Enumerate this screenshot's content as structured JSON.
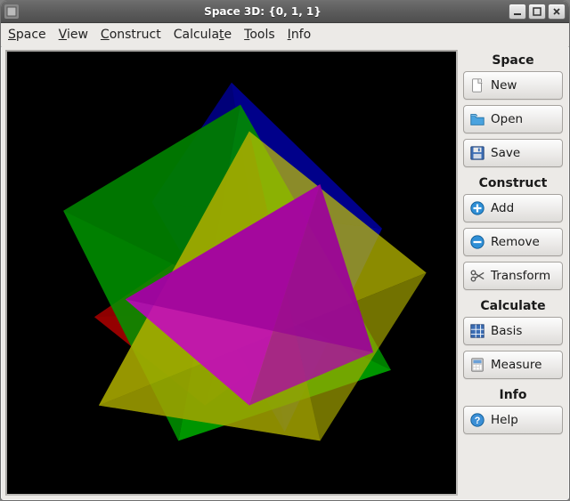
{
  "window": {
    "title": "Space 3D: {0, 1, 1}"
  },
  "menubar": {
    "items": [
      {
        "label": "Space",
        "accel_index": 0
      },
      {
        "label": "View",
        "accel_index": 0
      },
      {
        "label": "Construct",
        "accel_index": 0
      },
      {
        "label": "Calculate",
        "accel_index": 7
      },
      {
        "label": "Tools",
        "accel_index": 0
      },
      {
        "label": "Info",
        "accel_index": 0
      }
    ]
  },
  "sidebar": {
    "sections": [
      {
        "title": "Space",
        "buttons": [
          {
            "name": "new-button",
            "icon": "file-new-icon",
            "label": "New"
          },
          {
            "name": "open-button",
            "icon": "folder-open-icon",
            "label": "Open"
          },
          {
            "name": "save-button",
            "icon": "save-icon",
            "label": "Save"
          }
        ]
      },
      {
        "title": "Construct",
        "buttons": [
          {
            "name": "add-button",
            "icon": "plus-icon",
            "label": "Add"
          },
          {
            "name": "remove-button",
            "icon": "minus-icon",
            "label": "Remove"
          },
          {
            "name": "transform-button",
            "icon": "scissors-icon",
            "label": "Transform"
          }
        ]
      },
      {
        "title": "Calculate",
        "buttons": [
          {
            "name": "basis-button",
            "icon": "grid-icon",
            "label": "Basis"
          },
          {
            "name": "measure-button",
            "icon": "calculator-icon",
            "label": "Measure"
          }
        ]
      },
      {
        "title": "Info",
        "buttons": [
          {
            "name": "help-button",
            "icon": "help-icon",
            "label": "Help"
          }
        ]
      }
    ]
  },
  "viewport": {
    "background": "#000000",
    "description": "Compound of five intersecting tetrahedra rendered with translucent faces",
    "objects": [
      {
        "type": "tetrahedron",
        "color": "#ff0000"
      },
      {
        "type": "tetrahedron",
        "color": "#00ff00"
      },
      {
        "type": "tetrahedron",
        "color": "#0000ff"
      },
      {
        "type": "tetrahedron",
        "color": "#ffff00"
      },
      {
        "type": "tetrahedron",
        "color": "#ff00ff"
      }
    ]
  }
}
